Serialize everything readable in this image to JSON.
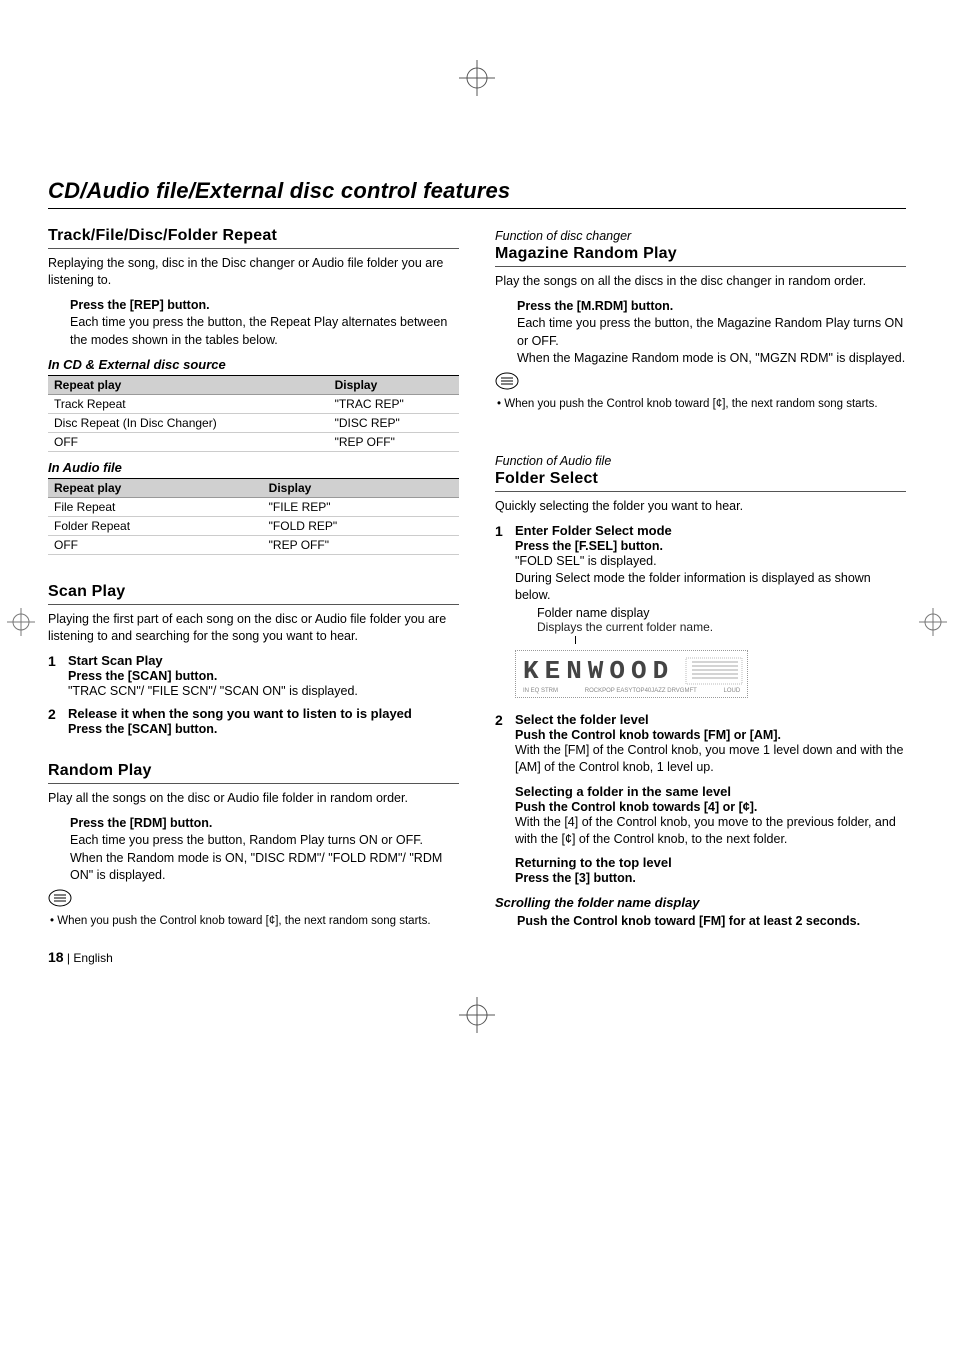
{
  "page": {
    "number": "18",
    "language_sep": "|",
    "language": "English"
  },
  "main_title": "CD/Audio file/External disc control features",
  "left": {
    "repeat": {
      "heading": "Track/File/Disc/Folder Repeat",
      "intro": "Replaying the song, disc in the Disc changer or Audio file folder you are listening to.",
      "press_label": "Press the [REP] button.",
      "press_desc": "Each time you press the button, the Repeat Play alternates between the modes shown in the tables below.",
      "cd_ext_label": "In CD & External disc source",
      "table_cdext": {
        "head_a": "Repeat play",
        "head_b": "Display",
        "rows": [
          {
            "a": "Track Repeat",
            "b": "\"TRAC REP\""
          },
          {
            "a": "Disc Repeat (In Disc Changer)",
            "b": "\"DISC REP\""
          },
          {
            "a": "OFF",
            "b": "\"REP OFF\""
          }
        ]
      },
      "audio_label": "In Audio file",
      "table_audio": {
        "head_a": "Repeat play",
        "head_b": "Display",
        "rows": [
          {
            "a": "File Repeat",
            "b": "\"FILE REP\""
          },
          {
            "a": "Folder Repeat",
            "b": "\"FOLD REP\""
          },
          {
            "a": "OFF",
            "b": "\"REP OFF\""
          }
        ]
      }
    },
    "scan": {
      "heading": "Scan Play",
      "intro": "Playing the first part of each song on the disc or Audio file folder you are listening to and searching for the song you want to hear.",
      "step1_num": "1",
      "step1_title": "Start Scan Play",
      "step1_instr": "Press the [SCAN] button.",
      "step1_desc": "\"TRAC SCN\"/ \"FILE SCN\"/ \"SCAN ON\" is displayed.",
      "step2_num": "2",
      "step2_title": "Release it when the song you want to listen to is played",
      "step2_instr": "Press the [SCAN] button."
    },
    "random": {
      "heading": "Random Play",
      "intro": "Play all the songs on the disc or Audio file folder in random order.",
      "press_label": "Press the [RDM] button.",
      "press_desc1": "Each time you press the button, Random Play turns ON or OFF.",
      "press_desc2": "When the Random mode is ON, \"DISC RDM\"/ \"FOLD RDM\"/ \"RDM ON\"  is displayed.",
      "note": "When you push the Control knob toward [¢], the next random song starts."
    }
  },
  "right": {
    "magazine": {
      "context": "Function of disc changer",
      "heading": "Magazine Random Play",
      "intro": "Play the songs on all the discs in the disc changer in random order.",
      "press_label": "Press the [M.RDM] button.",
      "press_desc1": "Each time you press the button, the Magazine Random Play turns ON or OFF.",
      "press_desc2": "When the Magazine Random mode is ON, \"MGZN RDM\" is displayed.",
      "note": "When you push the Control knob toward [¢], the next random song starts."
    },
    "folder": {
      "context": "Function of Audio file",
      "heading": "Folder Select",
      "intro": "Quickly selecting the folder you want to hear.",
      "step1_num": "1",
      "step1_title": "Enter Folder Select mode",
      "step1_instr": "Press the [F.SEL] button.",
      "step1_desc1": "\"FOLD SEL\" is displayed.",
      "step1_desc2": "During Select mode the folder information is displayed as shown below.",
      "lcd_label": "Folder name display",
      "lcd_desc": "Displays the current folder name.",
      "lcd_text": "KENWOOD",
      "step2_num": "2",
      "step2_title": "Select the folder level",
      "step2_instr": "Push the Control knob towards [FM] or [AM].",
      "step2_desc": "With the [FM] of the Control knob, you move 1 level down and with the [AM] of the Control knob, 1 level up.",
      "same_level_title": "Selecting a folder in the same level",
      "same_level_instr": "Push the Control knob towards [4] or [¢].",
      "same_level_desc": "With the [4] of the Control knob, you move to the previous folder, and with the [¢] of the Control knob, to the next folder.",
      "return_title": "Returning to the top level",
      "return_instr": "Press the [3] button.",
      "scroll_title": "Scrolling the folder name display",
      "scroll_instr": "Push the Control knob toward [FM] for at least 2 seconds."
    }
  },
  "icons": {
    "note": "note-icon",
    "skip_fwd": "▶▶|",
    "skip_back": "|◀◀"
  }
}
